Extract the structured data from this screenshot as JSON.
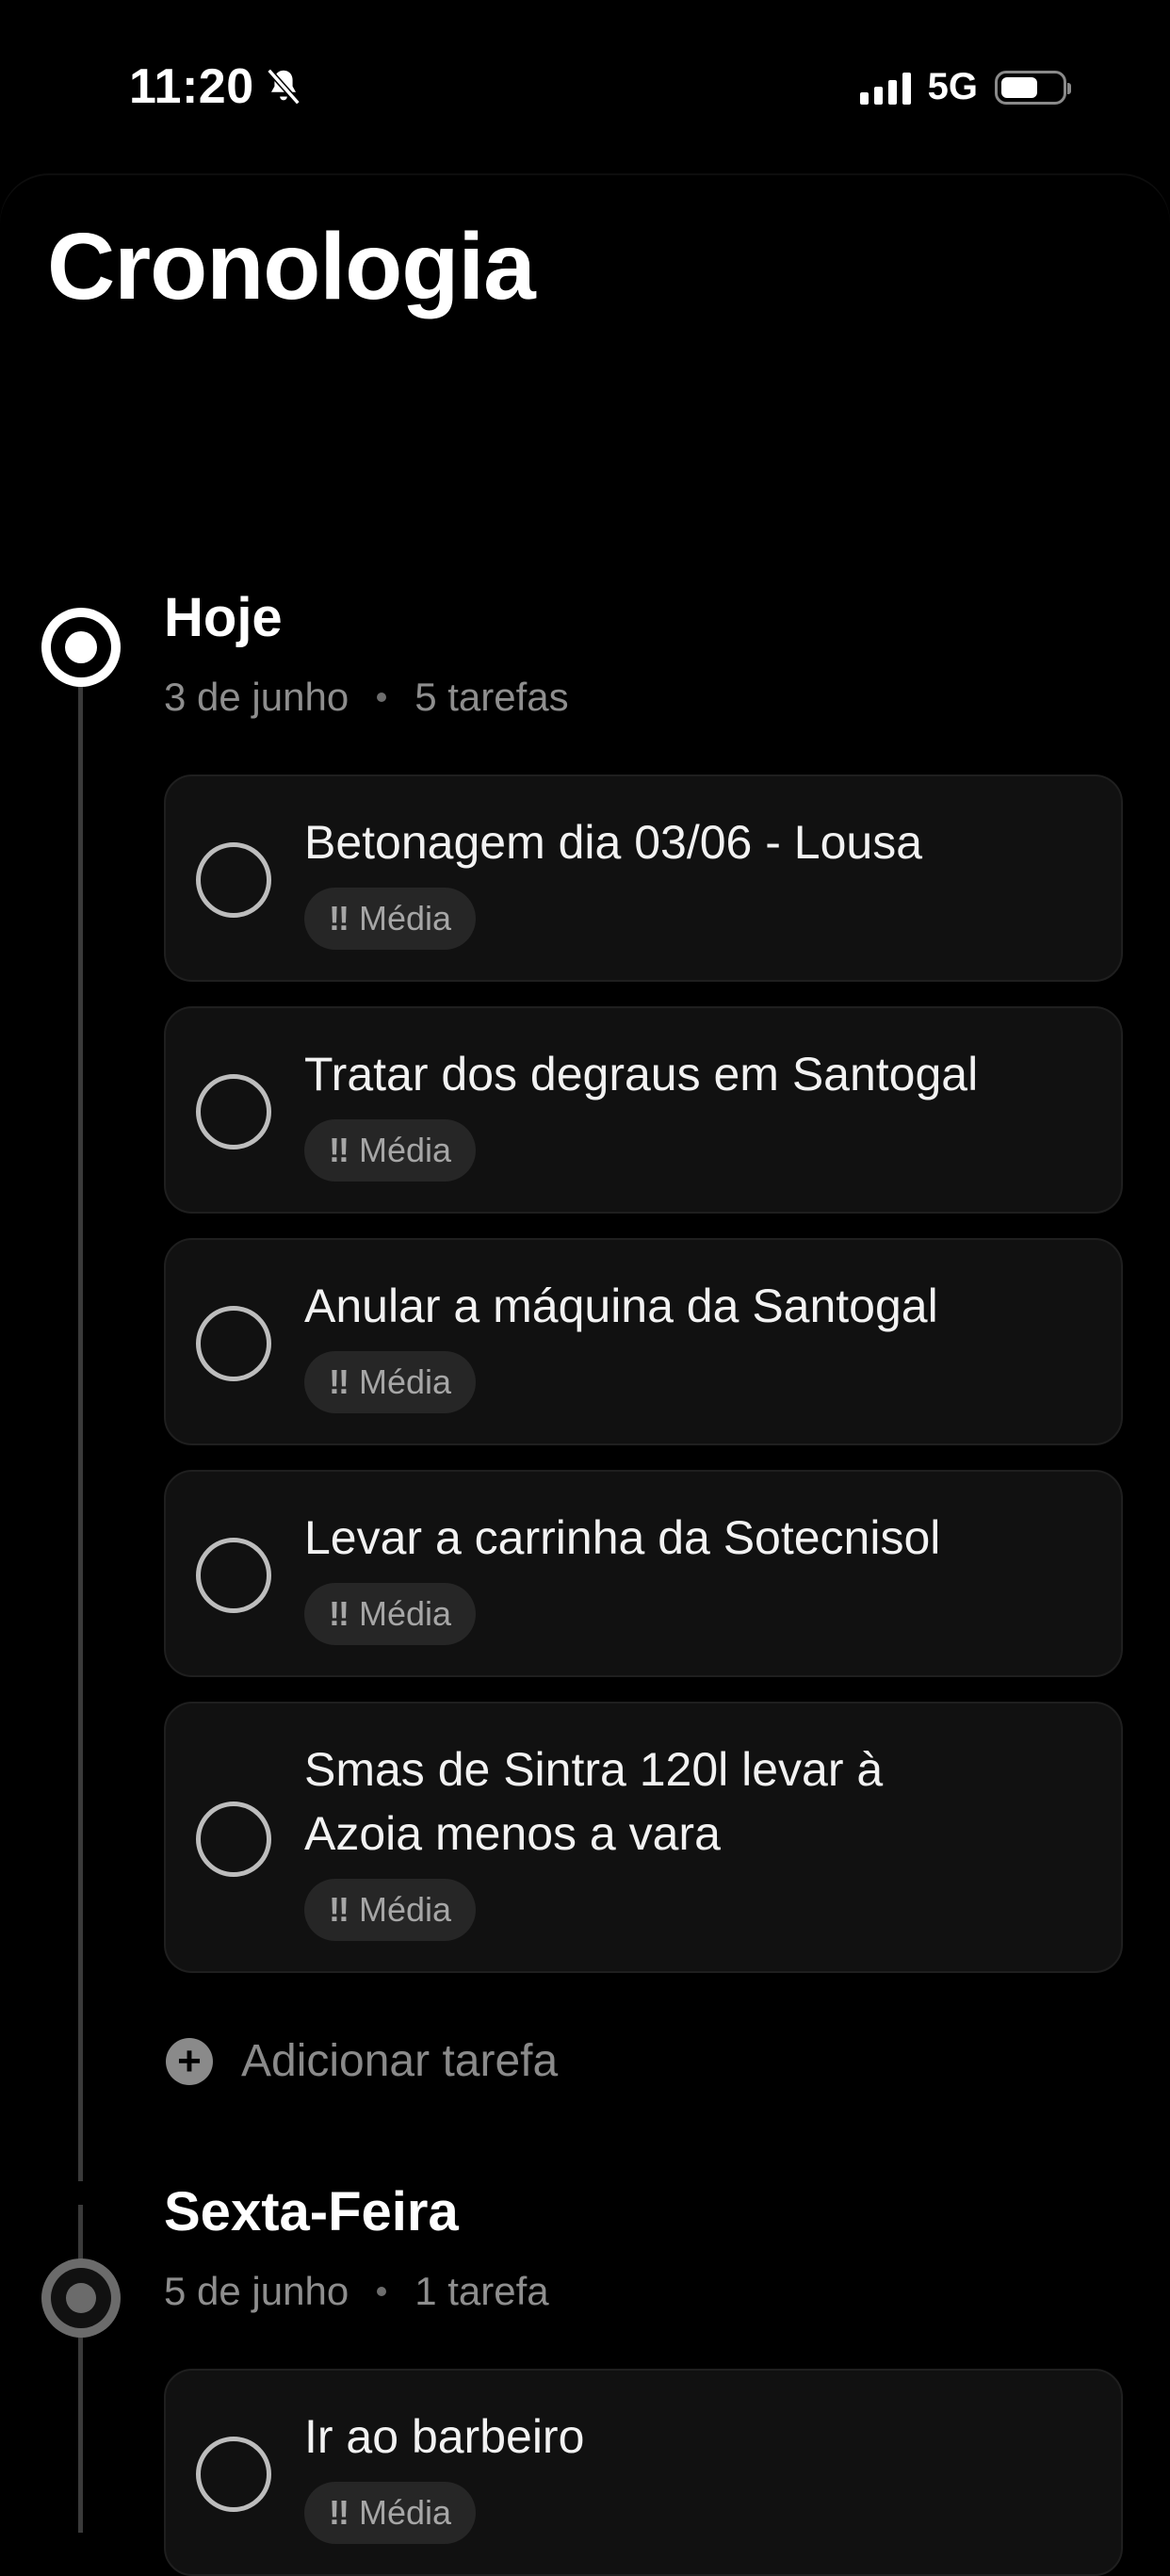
{
  "status_bar": {
    "time": "11:20",
    "network": "5G"
  },
  "page": {
    "title": "Cronologia"
  },
  "sections": [
    {
      "title": "Hoje",
      "date": "3 de junho",
      "count": "5 tarefas",
      "tasks": [
        {
          "title": "Betonagem dia 03/06 - Lousa",
          "priority": "Média"
        },
        {
          "title": "Tratar dos degraus em Santogal",
          "priority": "Média"
        },
        {
          "title": "Anular a máquina da Santogal",
          "priority": "Média"
        },
        {
          "title": "Levar a carrinha da Sotecnisol",
          "priority": "Média"
        },
        {
          "title": "Smas de Sintra 120l levar à Azoia menos a vara",
          "priority": "Média"
        }
      ],
      "add_label": "Adicionar tarefa"
    },
    {
      "title": "Sexta-Feira",
      "date": "5 de junho",
      "count": "1 tarefa",
      "tasks": [
        {
          "title": "Ir ao barbeiro",
          "priority": "Média"
        }
      ]
    }
  ],
  "priority_marker": "!!"
}
